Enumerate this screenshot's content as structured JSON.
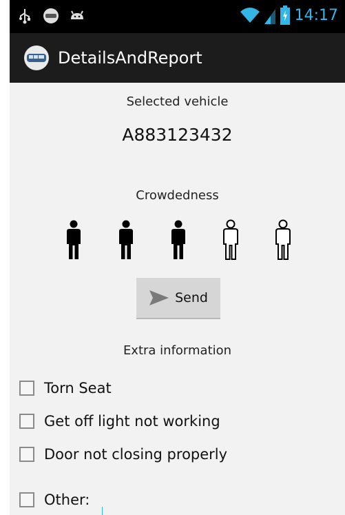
{
  "status_bar": {
    "time": "14:17",
    "icons": [
      "usb-icon",
      "app-notification-icon",
      "android-icon",
      "wifi-icon",
      "signal-icon",
      "battery-charging-icon"
    ],
    "accent_color": "#33b5e5"
  },
  "action_bar": {
    "title": "DetailsAndReport",
    "icon": "bus-app-icon"
  },
  "vehicle": {
    "label": "Selected vehicle",
    "id": "A883123432"
  },
  "crowdedness": {
    "label": "Crowdedness",
    "level": 3,
    "max": 5
  },
  "send_button": {
    "label": "Send",
    "icon": "send-icon"
  },
  "extra": {
    "label": "Extra information",
    "options": [
      {
        "label": "Torn Seat",
        "checked": false
      },
      {
        "label": "Get off light not working",
        "checked": false
      },
      {
        "label": "Door not closing properly",
        "checked": false
      },
      {
        "label": "Other:",
        "checked": false
      }
    ]
  }
}
